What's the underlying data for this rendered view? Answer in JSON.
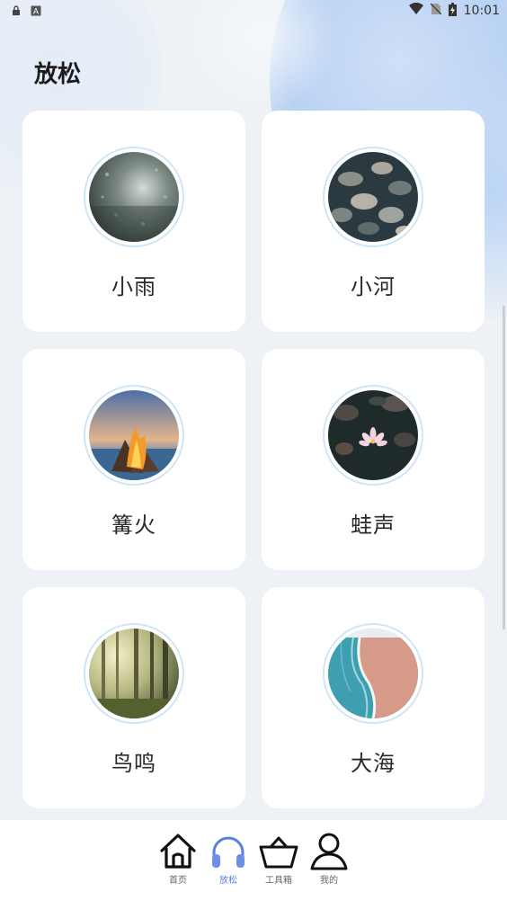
{
  "status_bar": {
    "time": "10:01",
    "left_icons": [
      "lock-notification-icon",
      "a-notification-icon"
    ],
    "right_icons": [
      "wifi-icon",
      "no-sim-icon",
      "battery-charging-icon"
    ]
  },
  "page": {
    "title": "放松"
  },
  "cards": [
    {
      "label": "小雨",
      "image": "rain-window-photo"
    },
    {
      "label": "小河",
      "image": "river-rocks-photo"
    },
    {
      "label": "篝火",
      "image": "campfire-photo"
    },
    {
      "label": "蛙声",
      "image": "lotus-pond-photo"
    },
    {
      "label": "鸟鸣",
      "image": "forest-photo"
    },
    {
      "label": "大海",
      "image": "ocean-beach-photo"
    }
  ],
  "bottom_nav": {
    "items": [
      {
        "label": "首页",
        "icon": "home-icon",
        "active": false
      },
      {
        "label": "放松",
        "icon": "headphones-icon",
        "active": true
      },
      {
        "label": "工具箱",
        "icon": "basket-icon",
        "active": false
      },
      {
        "label": "我的",
        "icon": "user-icon",
        "active": false
      }
    ]
  },
  "colors": {
    "accent": "#5a7fe0",
    "background": "#eef1f5",
    "card": "#ffffff",
    "thumb_ring": "#cfe6f6"
  }
}
